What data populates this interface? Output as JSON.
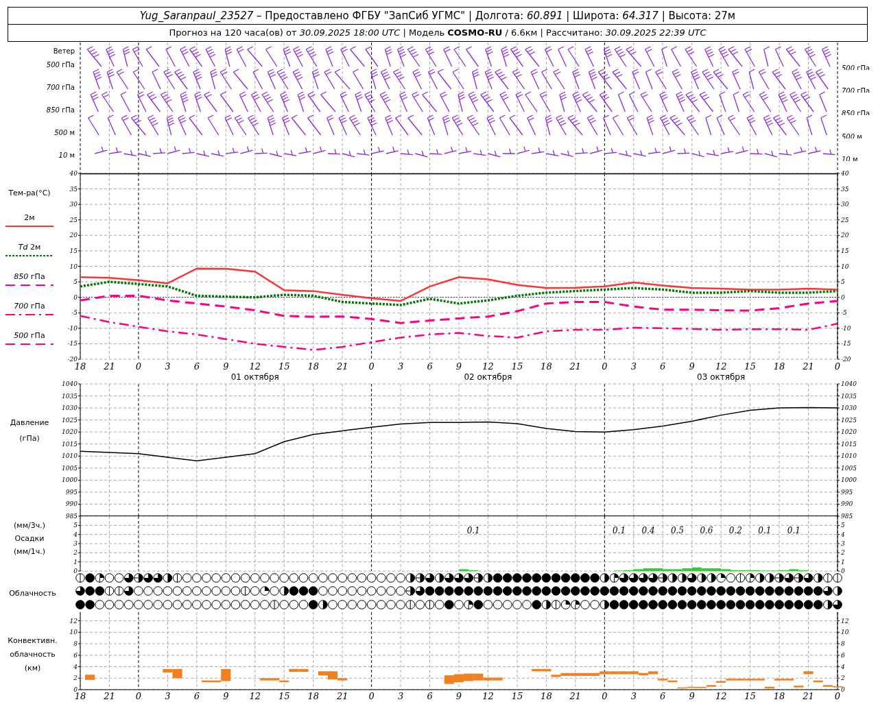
{
  "header": {
    "lines": [
      "*Yug_Saranpaul_23527* – Предоставлено ФГБУ \"ЗапСиб УГМС\" | Долгота: *60.891* | Широта: *64.317* | Высота: 27м",
      "Прогноз на 120 часа(ов) от *30.09.2025 18:00 UTC* | Модель **COSMO-RU** / 6.6км | Рассчитано: *30.09.2025 22:39 UTC*"
    ]
  },
  "wind": {
    "title": "Ветер",
    "levels": [
      {
        "label": "*500* гПа",
        "right_label": "*500* гПа",
        "kind": "upper"
      },
      {
        "label": "*700* гПа",
        "right_label": "*700* гПа",
        "kind": "upper"
      },
      {
        "label": "*850* гПа",
        "right_label": "*850* гПа",
        "kind": "upper"
      },
      {
        "label": "*500* м",
        "right_label": "*500* м",
        "kind": "upper"
      },
      {
        "label": "*10* м",
        "right_label": "*10* м",
        "kind": "surface"
      }
    ]
  },
  "temperature": {
    "title": "Тем-ра(°C)",
    "days": [
      "01 октября",
      "02 октября",
      "03 октября"
    ],
    "right_ticks": [
      "40",
      "35",
      "30",
      "25",
      "20",
      "15",
      "10",
      "5",
      "0",
      "-5",
      "-10",
      "-15",
      "-20"
    ],
    "chart_data": {
      "type": "line",
      "categories": [
        "18",
        "21",
        "0",
        "3",
        "6",
        "9",
        "12",
        "15",
        "18",
        "21",
        "0",
        "3",
        "6",
        "9",
        "12",
        "15",
        "18",
        "21",
        "0",
        "3",
        "6",
        "9",
        "12",
        "15",
        "18",
        "21",
        "0"
      ],
      "series": [
        {
          "name": "2м",
          "line_style": "solid",
          "color": "#ff3333",
          "values": [
            6.5,
            6.3,
            5.5,
            4.5,
            9.3,
            9.2,
            8.3,
            2.3,
            2.0,
            0.8,
            -0.3,
            -1.2,
            3.5,
            6.5,
            5.8,
            4.0,
            3.0,
            3.1,
            3.5,
            4.8,
            3.8,
            3.0,
            2.8,
            2.5,
            2.5,
            2.8,
            2.5
          ]
        },
        {
          "name": "*Td* 2м",
          "line_style": "dotted",
          "color": "#007700",
          "values": [
            3.5,
            5.0,
            4.3,
            3.5,
            0.5,
            0.2,
            0.0,
            0.8,
            0.5,
            -1.5,
            -2.0,
            -2.5,
            -0.5,
            -2.0,
            -1.0,
            0.5,
            1.5,
            2.0,
            2.5,
            3.0,
            2.5,
            1.5,
            1.5,
            2.0,
            1.5,
            1.5,
            2.0
          ]
        },
        {
          "name": "*850* гПа",
          "line_style": "dashed",
          "color": "#ff0080",
          "values": [
            -1.0,
            0.5,
            0.5,
            -1.0,
            -2.0,
            -3.0,
            -4.2,
            -6.0,
            -6.3,
            -6.2,
            -7.0,
            -8.3,
            -7.5,
            -6.8,
            -6.2,
            -4.5,
            -2.0,
            -1.5,
            -1.5,
            -3.0,
            -4.0,
            -4.0,
            -4.2,
            -4.3,
            -3.5,
            -2.0,
            -1.2
          ]
        },
        {
          "name": "*700* гПа",
          "line_style": "dashdot",
          "color": "#ff0080",
          "values": [
            -6.0,
            -8.0,
            -9.5,
            -11.0,
            -12.0,
            -13.5,
            -15.0,
            -16.0,
            -17.0,
            -16.0,
            -14.5,
            -13.0,
            -12.0,
            -11.5,
            -12.5,
            -13.0,
            -11.0,
            -10.5,
            -10.5,
            -9.8,
            -10.0,
            -10.2,
            -10.5,
            -10.3,
            -10.3,
            -10.5,
            -8.5
          ]
        },
        {
          "name": "*500* гПа",
          "line_style": "dashed",
          "color": "#ff0080",
          "values": [
            null,
            null,
            null,
            null,
            null,
            null,
            null,
            null,
            null,
            null,
            null,
            null,
            null,
            null,
            null,
            null,
            null,
            null,
            null,
            null,
            null,
            null,
            null,
            null,
            null,
            null,
            null
          ]
        }
      ],
      "ref_lines": [
        {
          "axis": "y",
          "value": 0,
          "color": "#2222ff"
        }
      ],
      "ylim": [
        -20,
        40
      ],
      "yticks": [
        -20,
        -15,
        -10,
        -5,
        0,
        5,
        10,
        15,
        20,
        25,
        30,
        35,
        40
      ],
      "grid": true
    }
  },
  "pressure": {
    "labels": [
      "(гПа)"
    ],
    "right_ticks": [
      "1040",
      "1035",
      "1030",
      "1025",
      "1020",
      "1015",
      "1010",
      "1005",
      "1000",
      "995",
      "990",
      "985"
    ],
    "chart_data": {
      "type": "line",
      "categories": [
        null,
        null,
        null,
        null,
        null,
        null,
        null,
        null,
        null,
        null,
        null,
        null,
        null,
        null,
        null,
        null,
        null,
        null,
        null,
        null,
        null,
        null,
        null,
        null,
        null,
        null,
        null
      ],
      "series": [
        {
          "name": "Давление",
          "color": "#000000",
          "values": [
            1012,
            1011.5,
            1011,
            1009.5,
            1008,
            1009.5,
            1011,
            1016,
            1019,
            1020.5,
            1022,
            1023.3,
            1024,
            1024,
            1024.2,
            1023.5,
            1021.5,
            1020.2,
            1020,
            1021,
            1022.5,
            1024.5,
            1027,
            1029,
            1030,
            1030.2,
            1030
          ]
        }
      ],
      "ylim": [
        985,
        1040
      ],
      "yticks": [
        985,
        990,
        995,
        1000,
        1005,
        1010,
        1015,
        1020,
        1025,
        1030,
        1035,
        1040
      ],
      "grid": true
    }
  },
  "precipitation": {
    "labels": [
      "(мм/3ч.)",
      "(мм/1ч.)"
    ],
    "right_ticks": [
      "5",
      "4",
      "3",
      "2",
      "1",
      "0"
    ],
    "chart_data": {
      "type": "bar",
      "categories": [
        null,
        null,
        null,
        null,
        null,
        null,
        null,
        null,
        null,
        null,
        null,
        null,
        null,
        null,
        null,
        null,
        null,
        null,
        null,
        null,
        null,
        null,
        null,
        null,
        null,
        null,
        null,
        null,
        null,
        null,
        null,
        null,
        null,
        null,
        null,
        null,
        null,
        null,
        null,
        null,
        null,
        null,
        null,
        null,
        null,
        null,
        null,
        null,
        null,
        null,
        null,
        null,
        null,
        null,
        null,
        null,
        null,
        null,
        null,
        null,
        null,
        null,
        null,
        null,
        null,
        null,
        null,
        null,
        null,
        null,
        null,
        null,
        null,
        null,
        null,
        null,
        null,
        null
      ],
      "series": [
        {
          "name": "Осадки",
          "color": "#33cc33",
          "values": [
            0,
            0,
            0,
            0,
            0,
            0,
            0,
            0,
            0,
            0,
            0,
            0,
            0,
            0,
            0,
            0,
            0,
            0,
            0,
            0,
            0,
            0,
            0,
            0,
            0,
            0,
            0,
            0,
            0,
            0,
            0,
            0,
            0,
            0,
            0,
            0,
            0,
            0,
            0,
            0.2,
            0.1,
            0,
            0,
            0,
            0,
            0,
            0,
            0,
            0,
            0,
            0,
            0,
            0,
            0,
            0,
            0.05,
            0.1,
            0.2,
            0.3,
            0.3,
            0.2,
            0.2,
            0.3,
            0.4,
            0.3,
            0.3,
            0.2,
            0.1,
            0.1,
            0.1,
            0.05,
            0.05,
            0.1,
            0.2,
            0.1,
            0,
            0,
            0
          ]
        }
      ],
      "value_labels": [
        null,
        null,
        null,
        null,
        null,
        null,
        null,
        null,
        null,
        null,
        null,
        null,
        null,
        null,
        null,
        null,
        null,
        null,
        null,
        null,
        null,
        null,
        null,
        null,
        null,
        null,
        null,
        null,
        null,
        null,
        null,
        null,
        null,
        null,
        null,
        null,
        null,
        null,
        null,
        null,
        "0.1",
        null,
        null,
        null,
        null,
        null,
        null,
        null,
        null,
        null,
        null,
        null,
        null,
        null,
        null,
        "0.1",
        null,
        null,
        "0.4",
        null,
        null,
        "0.5",
        null,
        null,
        "0.6",
        null,
        null,
        "0.2",
        null,
        null,
        "0.1",
        null,
        null,
        "0.1",
        null,
        null,
        null,
        null
      ],
      "ylim": [
        0,
        6
      ],
      "yticks": [
        0,
        1,
        2,
        3,
        4,
        5
      ],
      "grid": true
    }
  },
  "cloudiness": {
    "label": "Облачность",
    "symbol_rows": [
      {
        "cells": [
          {
            "kind": "one"
          },
          {
            "kind": "eight"
          },
          {
            "kind": "three"
          },
          {
            "kind": "zero"
          },
          {
            "kind": "zero"
          },
          {
            "kind": "six"
          },
          {
            "kind": "five"
          },
          {
            "kind": "six"
          },
          {
            "kind": "six"
          },
          {
            "kind": "four"
          },
          {
            "kind": "one"
          },
          {
            "kind": "zero"
          },
          {
            "kind": "zero"
          },
          {
            "kind": "zero"
          },
          {
            "kind": "zero"
          },
          {
            "kind": "zero"
          },
          {
            "kind": "zero"
          },
          {
            "kind": "zero"
          },
          {
            "kind": "zero"
          },
          {
            "kind": "zero"
          },
          {
            "kind": "zero"
          },
          {
            "kind": "zero"
          },
          {
            "kind": "zero"
          },
          {
            "kind": "zero"
          },
          {
            "kind": "zero"
          },
          {
            "kind": "zero"
          },
          {
            "kind": "zero"
          },
          {
            "kind": "zero"
          },
          {
            "kind": "zero"
          },
          {
            "kind": "zero"
          },
          {
            "kind": "zero"
          },
          {
            "kind": "zero"
          },
          {
            "kind": "zero"
          },
          {
            "kind": "zero"
          },
          {
            "kind": "four"
          },
          {
            "kind": "five"
          },
          {
            "kind": "six"
          },
          {
            "kind": "four"
          },
          {
            "kind": "six"
          },
          {
            "kind": "six"
          },
          {
            "kind": "six"
          },
          {
            "kind": "five"
          },
          {
            "kind": "four"
          },
          {
            "kind": "eight"
          },
          {
            "kind": "eight"
          },
          {
            "kind": "eight"
          },
          {
            "kind": "eight"
          },
          {
            "kind": "eight"
          },
          {
            "kind": "eight"
          },
          {
            "kind": "eight"
          },
          {
            "kind": "eight"
          },
          {
            "kind": "eight"
          },
          {
            "kind": "eight"
          },
          {
            "kind": "eight"
          },
          {
            "kind": "four"
          },
          {
            "kind": "three"
          },
          {
            "kind": "six"
          },
          {
            "kind": "six"
          },
          {
            "kind": "six"
          },
          {
            "kind": "six"
          },
          {
            "kind": "five"
          },
          {
            "kind": "four"
          },
          {
            "kind": "four"
          },
          {
            "kind": "six"
          },
          {
            "kind": "four"
          },
          {
            "kind": "four"
          },
          {
            "kind": "two"
          },
          {
            "kind": "zero"
          },
          {
            "kind": "one"
          },
          {
            "kind": "three"
          },
          {
            "kind": "four"
          },
          {
            "kind": "four"
          },
          {
            "kind": "five"
          },
          {
            "kind": "six"
          },
          {
            "kind": "five"
          },
          {
            "kind": "six"
          },
          {
            "kind": "four"
          },
          {
            "kind": "one"
          },
          {
            "kind": "one"
          }
        ]
      },
      {
        "cells": [
          {
            "kind": "six"
          },
          {
            "kind": "eight"
          },
          {
            "kind": "eight"
          },
          {
            "kind": "one"
          },
          {
            "kind": "one"
          },
          {
            "kind": "six"
          },
          {
            "kind": "zero"
          },
          {
            "kind": "zero"
          },
          {
            "kind": "zero"
          },
          {
            "kind": "zero"
          },
          {
            "kind": "zero"
          },
          {
            "kind": "zero"
          },
          {
            "kind": "zero"
          },
          {
            "kind": "zero"
          },
          {
            "kind": "zero"
          },
          {
            "kind": "zero"
          },
          {
            "kind": "zero"
          },
          {
            "kind": "one"
          },
          {
            "kind": "zero"
          },
          {
            "kind": "two"
          },
          {
            "kind": "zero"
          },
          {
            "kind": "four"
          },
          {
            "kind": "eight"
          },
          {
            "kind": "eight"
          },
          {
            "kind": "eight"
          },
          {
            "kind": "zero"
          },
          {
            "kind": "zero"
          },
          {
            "kind": "zero"
          },
          {
            "kind": "zero"
          },
          {
            "kind": "zero"
          },
          {
            "kind": "zero"
          },
          {
            "kind": "zero"
          },
          {
            "kind": "zero"
          },
          {
            "kind": "zero"
          },
          {
            "kind": "five"
          },
          {
            "kind": "six"
          },
          {
            "kind": "eight"
          },
          {
            "kind": "eight"
          },
          {
            "kind": "eight"
          },
          {
            "kind": "eight"
          },
          {
            "kind": "eight"
          },
          {
            "kind": "eight"
          },
          {
            "kind": "eight"
          },
          {
            "kind": "eight"
          },
          {
            "kind": "eight"
          },
          {
            "kind": "eight"
          },
          {
            "kind": "eight"
          },
          {
            "kind": "eight"
          },
          {
            "kind": "eight"
          },
          {
            "kind": "eight"
          },
          {
            "kind": "eight"
          },
          {
            "kind": "eight"
          },
          {
            "kind": "eight"
          },
          {
            "kind": "eight"
          },
          {
            "kind": "eight"
          },
          {
            "kind": "eight"
          },
          {
            "kind": "eight"
          },
          {
            "kind": "eight"
          },
          {
            "kind": "eight"
          },
          {
            "kind": "eight"
          },
          {
            "kind": "eight"
          },
          {
            "kind": "eight"
          },
          {
            "kind": "eight"
          },
          {
            "kind": "eight"
          },
          {
            "kind": "eight"
          },
          {
            "kind": "eight"
          },
          {
            "kind": "eight"
          },
          {
            "kind": "eight"
          },
          {
            "kind": "eight"
          },
          {
            "kind": "eight"
          },
          {
            "kind": "eight"
          },
          {
            "kind": "eight"
          },
          {
            "kind": "eight"
          },
          {
            "kind": "eight"
          },
          {
            "kind": "eight"
          },
          {
            "kind": "eight"
          },
          {
            "kind": "eight"
          },
          {
            "kind": "six"
          },
          {
            "kind": "four"
          }
        ]
      },
      {
        "cells": [
          {
            "kind": "eight"
          },
          {
            "kind": "eight"
          },
          {
            "kind": "zero"
          },
          {
            "kind": "zero"
          },
          {
            "kind": "zero"
          },
          {
            "kind": "zero"
          },
          {
            "kind": "zero"
          },
          {
            "kind": "zero"
          },
          {
            "kind": "zero"
          },
          {
            "kind": "zero"
          },
          {
            "kind": "zero"
          },
          {
            "kind": "zero"
          },
          {
            "kind": "zero"
          },
          {
            "kind": "zero"
          },
          {
            "kind": "zero"
          },
          {
            "kind": "zero"
          },
          {
            "kind": "zero"
          },
          {
            "kind": "zero"
          },
          {
            "kind": "zero"
          },
          {
            "kind": "zero"
          },
          {
            "kind": "one"
          },
          {
            "kind": "zero"
          },
          {
            "kind": "zero"
          },
          {
            "kind": "zero"
          },
          {
            "kind": "eight"
          },
          {
            "kind": "four"
          },
          {
            "kind": "zero"
          },
          {
            "kind": "zero"
          },
          {
            "kind": "zero"
          },
          {
            "kind": "zero"
          },
          {
            "kind": "zero"
          },
          {
            "kind": "zero"
          },
          {
            "kind": "zero"
          },
          {
            "kind": "zero"
          },
          {
            "kind": "one"
          },
          {
            "kind": "zero"
          },
          {
            "kind": "one"
          },
          {
            "kind": "zero"
          },
          {
            "kind": "eight"
          },
          {
            "kind": "zero"
          },
          {
            "kind": "three"
          },
          {
            "kind": "eight"
          },
          {
            "kind": "zero"
          },
          {
            "kind": "zero"
          },
          {
            "kind": "zero"
          },
          {
            "kind": "zero"
          },
          {
            "kind": "zero"
          },
          {
            "kind": "eight"
          },
          {
            "kind": "four"
          },
          {
            "kind": "one"
          },
          {
            "kind": "two"
          },
          {
            "kind": "three"
          },
          {
            "kind": "zero"
          },
          {
            "kind": "zero"
          },
          {
            "kind": "four"
          },
          {
            "kind": "eight"
          },
          {
            "kind": "eight"
          },
          {
            "kind": "eight"
          },
          {
            "kind": "eight"
          },
          {
            "kind": "eight"
          },
          {
            "kind": "eight"
          },
          {
            "kind": "eight"
          },
          {
            "kind": "eight"
          },
          {
            "kind": "eight"
          },
          {
            "kind": "eight"
          },
          {
            "kind": "eight"
          },
          {
            "kind": "eight"
          },
          {
            "kind": "eight"
          },
          {
            "kind": "eight"
          },
          {
            "kind": "eight"
          },
          {
            "kind": "eight"
          },
          {
            "kind": "eight"
          },
          {
            "kind": "eight"
          },
          {
            "kind": "eight"
          },
          {
            "kind": "eight"
          },
          {
            "kind": "eight"
          },
          {
            "kind": "eight"
          },
          {
            "kind": "four"
          },
          {
            "kind": "six"
          }
        ]
      }
    ]
  },
  "convective": {
    "labels": [
      "Конвективн.",
      "облачность",
      "(км)"
    ],
    "right_ticks": [
      "12",
      "10",
      "8",
      "6",
      "4",
      "2",
      "0"
    ],
    "chart_data": {
      "type": "candlestick",
      "color": "#f08020",
      "categories": [
        "18",
        null,
        null,
        "21",
        null,
        null,
        "0",
        null,
        null,
        "3",
        null,
        null,
        "6",
        null,
        null,
        "9",
        null,
        null,
        "12",
        null,
        null,
        "15",
        null,
        null,
        "18",
        null,
        null,
        "21",
        null,
        null,
        "0",
        null,
        null,
        "3",
        null,
        null,
        "6",
        null,
        null,
        "9",
        null,
        null,
        "12",
        null,
        null,
        "15",
        null,
        null,
        "18",
        null,
        null,
        "21",
        null,
        null,
        "0",
        null,
        null,
        "3",
        null,
        null,
        "6",
        null,
        null,
        "9",
        null,
        null,
        "12",
        null,
        null,
        "15",
        null,
        null,
        "18",
        null,
        null,
        "21",
        null,
        null,
        "0"
      ],
      "ohlc": [
        null,
        [
          1.7,
          2.6,
          1.7,
          2.6
        ],
        null,
        null,
        null,
        null,
        null,
        null,
        null,
        [
          3.0,
          3.6,
          3.0,
          3.6
        ],
        [
          2.0,
          3.6,
          2.0,
          3.6
        ],
        null,
        null,
        [
          1.3,
          1.6,
          1.3,
          1.6
        ],
        [
          1.3,
          1.6,
          1.3,
          1.6
        ],
        [
          1.5,
          3.6,
          1.5,
          3.6
        ],
        null,
        null,
        null,
        [
          1.6,
          2.0,
          1.6,
          2.0
        ],
        [
          1.6,
          2.0,
          1.6,
          2.0
        ],
        [
          1.3,
          1.6,
          1.3,
          1.6
        ],
        [
          3.1,
          3.6,
          3.1,
          3.6
        ],
        [
          3.1,
          3.6,
          3.1,
          3.6
        ],
        null,
        [
          2.5,
          3.2,
          2.5,
          3.2
        ],
        [
          1.8,
          3.2,
          1.8,
          3.2
        ],
        [
          1.6,
          2.0,
          1.6,
          2.0
        ],
        null,
        null,
        null,
        null,
        null,
        null,
        null,
        null,
        null,
        null,
        [
          1.0,
          2.5,
          1.0,
          2.5
        ],
        [
          1.3,
          2.7,
          1.3,
          2.7
        ],
        [
          1.5,
          2.8,
          1.5,
          2.8
        ],
        [
          1.6,
          2.8,
          1.6,
          2.8
        ],
        [
          1.6,
          2.1,
          1.6,
          2.1
        ],
        [
          1.6,
          2.1,
          1.6,
          2.1
        ],
        null,
        null,
        null,
        [
          3.2,
          3.6,
          3.2,
          3.6
        ],
        [
          3.2,
          3.6,
          3.2,
          3.6
        ],
        [
          2.2,
          2.6,
          2.2,
          2.6
        ],
        [
          2.4,
          2.9,
          2.4,
          2.9
        ],
        [
          2.4,
          2.9,
          2.4,
          2.9
        ],
        [
          2.4,
          2.9,
          2.4,
          2.9
        ],
        [
          2.4,
          2.9,
          2.4,
          2.9
        ],
        [
          2.7,
          3.2,
          2.7,
          3.2
        ],
        [
          2.7,
          3.2,
          2.7,
          3.2
        ],
        [
          2.7,
          3.2,
          2.7,
          3.2
        ],
        [
          2.7,
          3.2,
          2.7,
          3.2
        ],
        [
          2.5,
          2.9,
          2.5,
          2.9
        ],
        [
          2.7,
          3.2,
          2.7,
          3.2
        ],
        [
          1.6,
          1.9,
          1.6,
          1.9
        ],
        [
          1.3,
          1.6,
          1.3,
          1.6
        ],
        [
          0.2,
          0.4,
          0.2,
          0.4
        ],
        [
          0.3,
          0.5,
          0.3,
          0.5
        ],
        [
          0.3,
          0.5,
          0.3,
          0.5
        ],
        [
          0.5,
          0.8,
          0.5,
          0.8
        ],
        [
          1.2,
          1.5,
          1.2,
          1.5
        ],
        [
          1.6,
          1.9,
          1.6,
          1.9
        ],
        [
          1.6,
          1.9,
          1.6,
          1.9
        ],
        [
          1.6,
          1.9,
          1.6,
          1.9
        ],
        [
          1.6,
          1.9,
          1.6,
          1.9
        ],
        [
          0.2,
          0.5,
          0.2,
          0.5
        ],
        [
          1.6,
          1.9,
          1.6,
          1.9
        ],
        [
          1.6,
          1.9,
          1.6,
          1.9
        ],
        [
          0.4,
          0.7,
          0.4,
          0.7
        ],
        [
          2.7,
          3.2,
          2.7,
          3.2
        ],
        [
          1.3,
          1.6,
          1.3,
          1.6
        ],
        [
          0.5,
          0.8,
          0.5,
          0.8
        ],
        [
          0.4,
          0.6,
          0.4,
          0.6
        ]
      ],
      "ylim": [
        0,
        13.5
      ],
      "yticks": [
        0,
        2,
        4,
        6,
        8,
        10,
        12
      ],
      "grid": true
    }
  }
}
